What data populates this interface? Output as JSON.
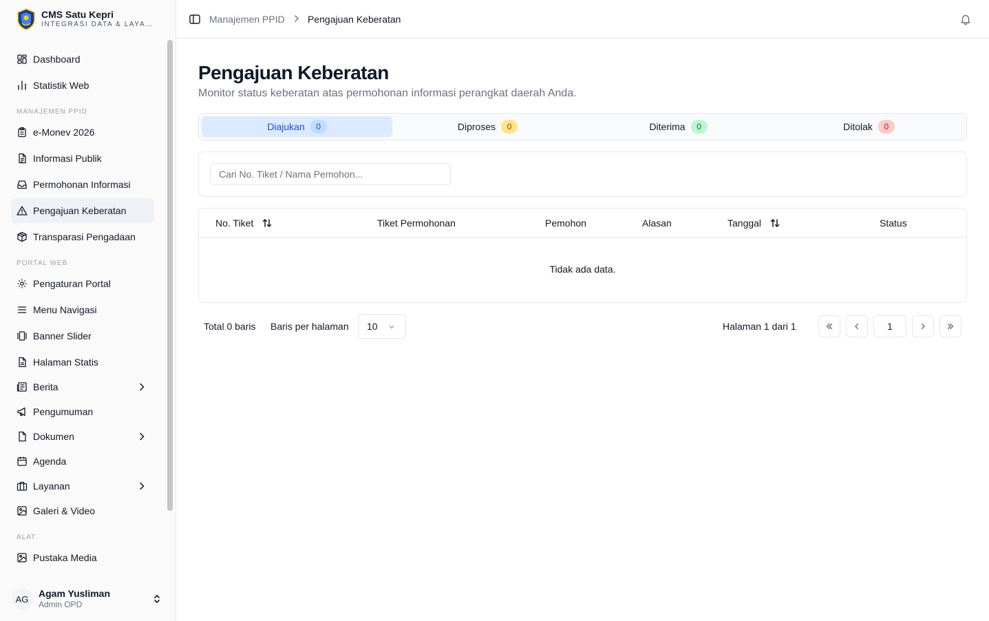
{
  "brand": {
    "title": "CMS Satu Kepri",
    "subtitle": "INTEGRASI DATA & LAYANAN"
  },
  "sidebar": {
    "top_items": [
      {
        "label": "Dashboard",
        "icon": "dashboard-icon"
      },
      {
        "label": "Statistik Web",
        "icon": "bar-chart-icon"
      }
    ],
    "groups": {
      "ppid": "MANAJEMEN PPID",
      "portal": "PORTAL WEB",
      "alat": "ALAT"
    },
    "ppid_items": [
      {
        "label": "e-Monev 2026",
        "icon": "clipboard-icon"
      },
      {
        "label": "Informasi Publik",
        "icon": "file-text-icon"
      },
      {
        "label": "Permohonan Informasi",
        "icon": "inbox-icon"
      },
      {
        "label": "Pengajuan Keberatan",
        "icon": "warning-icon",
        "active": true
      },
      {
        "label": "Transparasi Pengadaan",
        "icon": "package-icon"
      }
    ],
    "portal_items": [
      {
        "label": "Pengaturan Portal",
        "icon": "gear-icon"
      },
      {
        "label": "Menu Navigasi",
        "icon": "menu-icon"
      },
      {
        "label": "Banner Slider",
        "icon": "gallery-icon"
      },
      {
        "label": "Halaman Statis",
        "icon": "file-icon"
      },
      {
        "label": "Berita",
        "icon": "newspaper-icon",
        "expandable": true
      },
      {
        "label": "Pengumuman",
        "icon": "megaphone-icon"
      },
      {
        "label": "Dokumen",
        "icon": "document-icon",
        "expandable": true
      },
      {
        "label": "Agenda",
        "icon": "calendar-icon"
      },
      {
        "label": "Layanan",
        "icon": "briefcase-icon",
        "expandable": true
      },
      {
        "label": "Galeri & Video",
        "icon": "image-icon"
      }
    ],
    "alat_items": [
      {
        "label": "Pustaka Media",
        "icon": "image-icon"
      }
    ]
  },
  "user": {
    "initials": "AG",
    "name": "Agam Yusliman",
    "role": "Admin OPD"
  },
  "header": {
    "breadcrumb_parent": "Manajemen PPID",
    "breadcrumb_current": "Pengajuan Keberatan"
  },
  "page": {
    "title": "Pengajuan Keberatan",
    "description": "Monitor status keberatan atas permohonan informasi perangkat daerah Anda."
  },
  "tabs": [
    {
      "label": "Diajukan",
      "count": "0",
      "badge_bg": "#bfdbfe",
      "badge_fg": "#1d4ed8"
    },
    {
      "label": "Diproses",
      "count": "0",
      "badge_bg": "#fde68a",
      "badge_fg": "#92400e"
    },
    {
      "label": "Diterima",
      "count": "0",
      "badge_bg": "#bbf7d0",
      "badge_fg": "#166534"
    },
    {
      "label": "Ditolak",
      "count": "0",
      "badge_bg": "#fecaca",
      "badge_fg": "#991b1b"
    }
  ],
  "search": {
    "placeholder": "Cari No. Tiket / Nama Pemohon...",
    "value": ""
  },
  "table": {
    "columns": [
      "No. Tiket",
      "Tiket Permohonan",
      "Pemohon",
      "Alasan",
      "Tanggal",
      "Status"
    ],
    "empty_text": "Tidak ada data."
  },
  "pagination": {
    "total_text": "Total 0 baris",
    "rows_label": "Baris per halaman",
    "rows_value": "10",
    "page_text": "Halaman 1 dari 1",
    "current_page": "1"
  }
}
